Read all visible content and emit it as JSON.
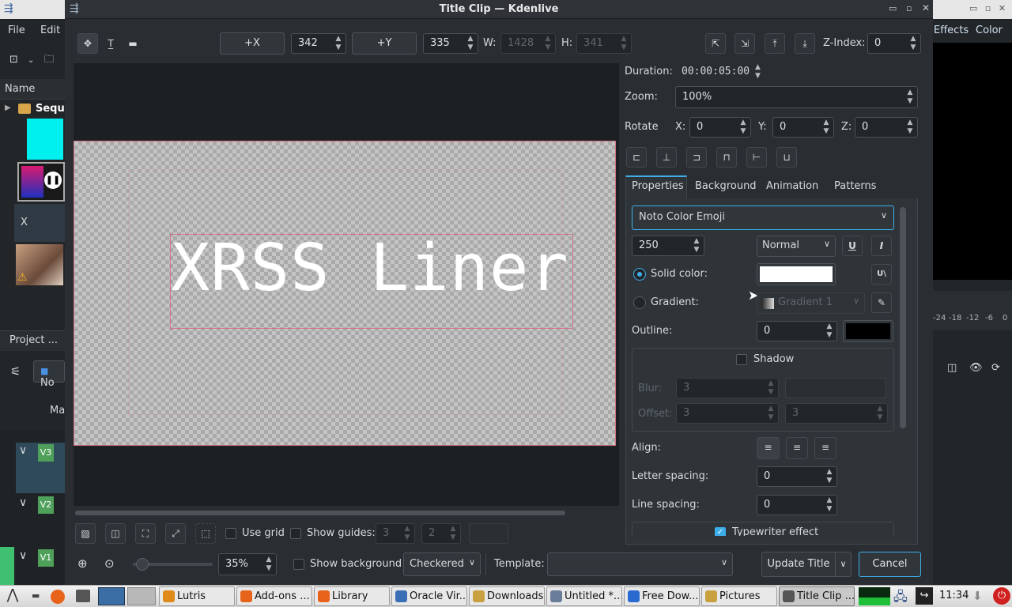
{
  "window": {
    "title": "Title Clip — Kdenlive",
    "ctrl_min": "▭",
    "ctrl_max": "▫",
    "ctrl_close": "✕"
  },
  "bg_left": {
    "menu_file": "File",
    "menu_edit": "Edit",
    "col_name": "Name",
    "folder": "Seque",
    "clip_x": "X",
    "tab_project": "Project ...",
    "dropdown": "No",
    "label_ma": "Ma",
    "tracks": [
      "V3",
      "V2",
      "V1"
    ]
  },
  "bg_right": {
    "menu_effects": "Effects",
    "menu_color": "Color",
    "ctrl_min": "▭",
    "ctrl_max": "▫",
    "ctrl_close": "✕",
    "meter_ticks": [
      "-24",
      "-18",
      "-12",
      "-6",
      "0"
    ]
  },
  "toolbar": {
    "plus_x": "+X",
    "x_value": "342",
    "plus_y": "+Y",
    "y_value": "335",
    "w_label": "W:",
    "w_value": "1428",
    "h_label": "H:",
    "h_value": "341",
    "zindex_label": "Z-Index:",
    "zindex_value": "0"
  },
  "canvas": {
    "title_text": "XRSS Liner"
  },
  "props": {
    "duration_label": "Duration:",
    "duration_value": "00:00:05:00",
    "zoom_label": "Zoom:",
    "zoom_value": "100%",
    "rotate_label": "Rotate",
    "rx_label": "X:",
    "rx_value": "0",
    "ry_label": "Y:",
    "ry_value": "0",
    "rz_label": "Z:",
    "rz_value": "0",
    "tabs": [
      "Properties",
      "Background",
      "Animation",
      "Patterns"
    ],
    "font": "Noto Color Emoji",
    "font_size": "250",
    "weight": "Normal",
    "solid_label": "Solid color:",
    "solid_color": "#ffffff",
    "gradient_label": "Gradient:",
    "gradient_value": "Gradient 1",
    "outline_label": "Outline:",
    "outline_value": "0",
    "outline_color": "#000000",
    "shadow_label": "Shadow",
    "blur_label": "Blur:",
    "blur_value": "3",
    "offset_label": "Offset:",
    "offset_x": "3",
    "offset_y": "3",
    "align_label": "Align:",
    "letter_label": "Letter spacing:",
    "letter_value": "0",
    "line_label": "Line spacing:",
    "line_value": "0",
    "typewriter_label": "Typewriter effect"
  },
  "bottom": {
    "use_grid": "Use grid",
    "show_guides": "Show guides:",
    "guide_a": "3",
    "guide_b": "2",
    "zoom_percent": "35%",
    "zoom_fill": 0.05,
    "show_background": "Show background",
    "background_value": "Checkered",
    "template_label": "Template:",
    "template_value": "",
    "update_title": "Update Title",
    "cancel": "Cancel"
  },
  "taskbar": {
    "items": [
      {
        "label": "Lutris",
        "color": "#e08a1a"
      },
      {
        "label": "Add-ons ...",
        "color": "#e8631a"
      },
      {
        "label": "Library",
        "color": "#e8631a"
      },
      {
        "label": "Oracle Vir...",
        "color": "#3a6fb5"
      },
      {
        "label": "Downloads",
        "color": "#c9a040"
      },
      {
        "label": "Untitled *...",
        "color": "#6a7d99"
      },
      {
        "label": "Free Dow...",
        "color": "#2a6ad0"
      },
      {
        "label": "Pictures",
        "color": "#c9a040"
      },
      {
        "label": "Title Clip ...",
        "color": "#555"
      }
    ],
    "clock": "11:34"
  }
}
